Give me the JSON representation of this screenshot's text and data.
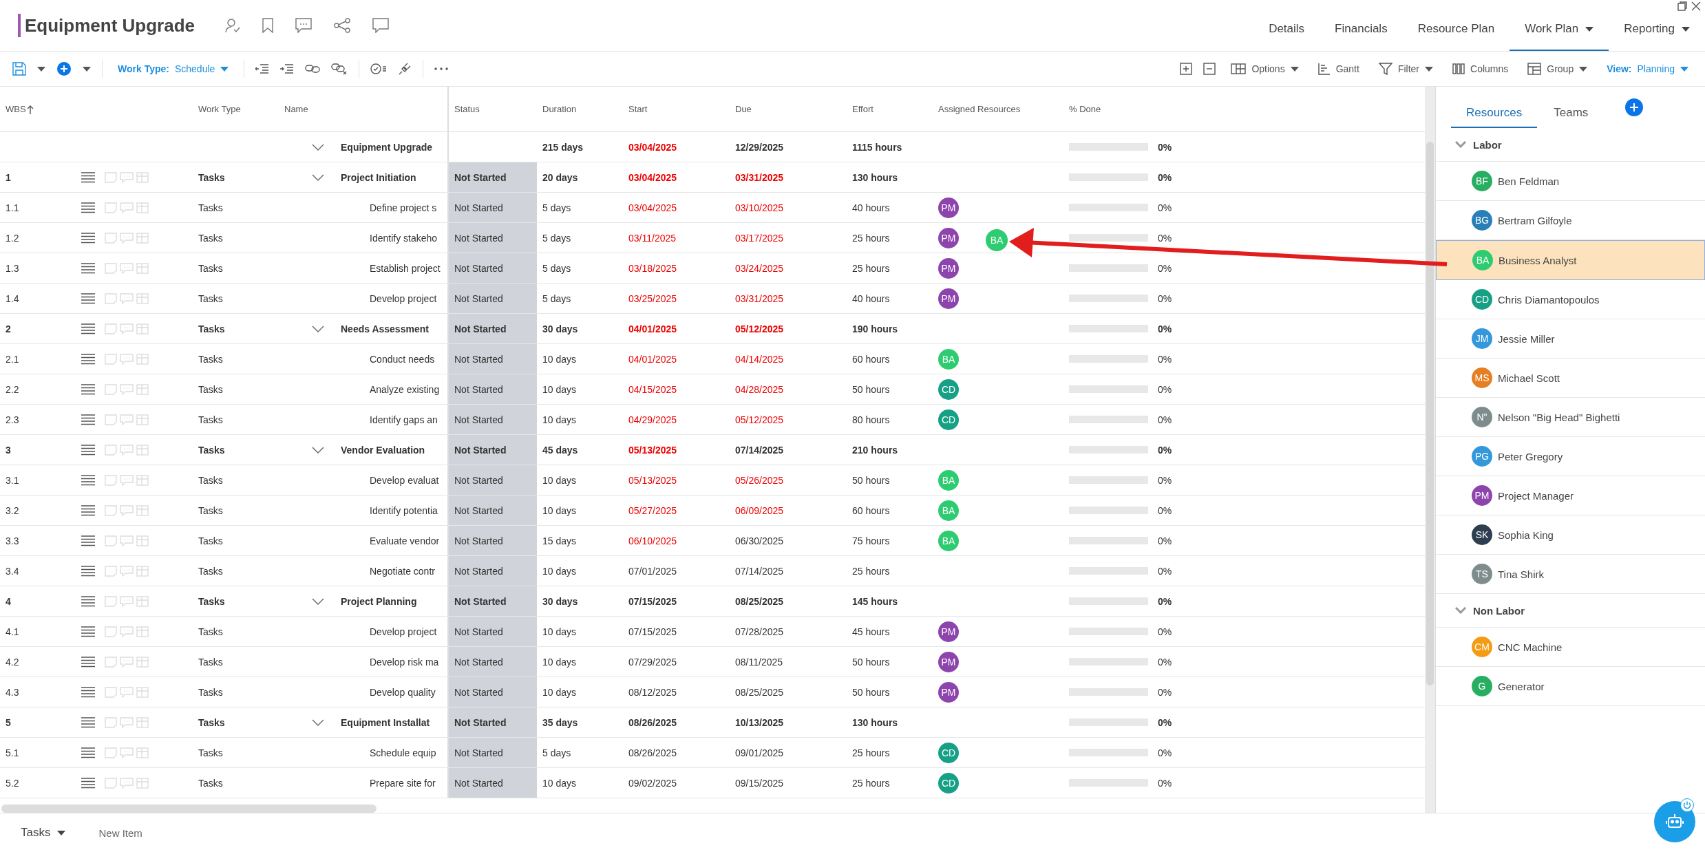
{
  "header": {
    "title": "Equipment Upgrade",
    "nav": [
      {
        "label": "Details",
        "selected": false,
        "dropdown": false
      },
      {
        "label": "Financials",
        "selected": false,
        "dropdown": false
      },
      {
        "label": "Resource Plan",
        "selected": false,
        "dropdown": false
      },
      {
        "label": "Work Plan",
        "selected": true,
        "dropdown": true
      },
      {
        "label": "Reporting",
        "selected": false,
        "dropdown": true
      }
    ]
  },
  "toolbar": {
    "work_type": {
      "label": "Work Type:",
      "value": "Schedule"
    },
    "right_buttons": [
      {
        "kind": "options",
        "label": "Options",
        "dropdown": true
      },
      {
        "kind": "gantt",
        "label": "Gantt",
        "dropdown": false
      },
      {
        "kind": "filter",
        "label": "Filter",
        "dropdown": true
      },
      {
        "kind": "columns",
        "label": "Columns",
        "dropdown": false
      },
      {
        "kind": "group",
        "label": "Group",
        "dropdown": true
      }
    ],
    "view": {
      "label": "View:",
      "value": "Planning"
    }
  },
  "table": {
    "columns": [
      "WBS",
      "Work Type",
      "Name",
      "Status",
      "Duration",
      "Start",
      "Due",
      "Effort",
      "Assigned Resources",
      "% Done"
    ],
    "rows": [
      {
        "kind": "summary",
        "wbs": "",
        "work_type": "",
        "name": "Equipment Upgrade",
        "expanded": true,
        "status": "",
        "duration": "215 days",
        "start": "03/04/2025",
        "start_late": true,
        "due": "12/29/2025",
        "due_late": false,
        "effort": "1115 hours",
        "resources": [],
        "level": 0,
        "done": "0%"
      },
      {
        "kind": "group",
        "wbs": "1",
        "work_type": "Tasks",
        "name": "Project Initiation",
        "expanded": true,
        "status": "Not Started",
        "duration": "20 days",
        "start": "03/04/2025",
        "start_late": true,
        "due": "03/31/2025",
        "due_late": true,
        "effort": "130 hours",
        "resources": [],
        "level": 0,
        "done": "0%"
      },
      {
        "kind": "task",
        "wbs": "1.1",
        "work_type": "Tasks",
        "name": "Define project s",
        "status": "Not Started",
        "duration": "5 days",
        "start": "03/04/2025",
        "start_late": true,
        "due": "03/10/2025",
        "due_late": true,
        "effort": "40 hours",
        "resources": [
          {
            "initials": "PM",
            "color": "#8e44ad"
          }
        ],
        "level": 0,
        "done": "0%"
      },
      {
        "kind": "task",
        "wbs": "1.2",
        "work_type": "Tasks",
        "name": "Identify stakeho",
        "status": "Not Started",
        "duration": "5 days",
        "start": "03/11/2025",
        "start_late": true,
        "due": "03/17/2025",
        "due_late": true,
        "effort": "25 hours",
        "resources": [
          {
            "initials": "PM",
            "color": "#8e44ad"
          }
        ],
        "level": 0,
        "done": "0%"
      },
      {
        "kind": "task",
        "wbs": "1.3",
        "work_type": "Tasks",
        "name": "Establish project",
        "status": "Not Started",
        "duration": "5 days",
        "start": "03/18/2025",
        "start_late": true,
        "due": "03/24/2025",
        "due_late": true,
        "effort": "25 hours",
        "resources": [
          {
            "initials": "PM",
            "color": "#8e44ad"
          }
        ],
        "level": 0,
        "done": "0%"
      },
      {
        "kind": "task",
        "wbs": "1.4",
        "work_type": "Tasks",
        "name": "Develop project",
        "status": "Not Started",
        "duration": "5 days",
        "start": "03/25/2025",
        "start_late": true,
        "due": "03/31/2025",
        "due_late": true,
        "effort": "40 hours",
        "resources": [
          {
            "initials": "PM",
            "color": "#8e44ad"
          }
        ],
        "level": 0,
        "done": "0%"
      },
      {
        "kind": "group",
        "wbs": "2",
        "work_type": "Tasks",
        "name": "Needs Assessment",
        "expanded": true,
        "status": "Not Started",
        "duration": "30 days",
        "start": "04/01/2025",
        "start_late": true,
        "due": "05/12/2025",
        "due_late": true,
        "effort": "190 hours",
        "resources": [],
        "level": 0,
        "done": "0%"
      },
      {
        "kind": "task",
        "wbs": "2.1",
        "work_type": "Tasks",
        "name": "Conduct needs",
        "status": "Not Started",
        "duration": "10 days",
        "start": "04/01/2025",
        "start_late": true,
        "due": "04/14/2025",
        "due_late": true,
        "effort": "60 hours",
        "resources": [
          {
            "initials": "BA",
            "color": "#2ecc71"
          }
        ],
        "level": 0,
        "done": "0%"
      },
      {
        "kind": "task",
        "wbs": "2.2",
        "work_type": "Tasks",
        "name": "Analyze existing",
        "status": "Not Started",
        "duration": "10 days",
        "start": "04/15/2025",
        "start_late": true,
        "due": "04/28/2025",
        "due_late": true,
        "effort": "50 hours",
        "resources": [
          {
            "initials": "CD",
            "color": "#16a085"
          }
        ],
        "level": 0,
        "done": "0%"
      },
      {
        "kind": "task",
        "wbs": "2.3",
        "work_type": "Tasks",
        "name": "Identify gaps an",
        "status": "Not Started",
        "duration": "10 days",
        "start": "04/29/2025",
        "start_late": true,
        "due": "05/12/2025",
        "due_late": true,
        "effort": "80 hours",
        "resources": [
          {
            "initials": "CD",
            "color": "#16a085"
          }
        ],
        "level": 0,
        "done": "0%"
      },
      {
        "kind": "group",
        "wbs": "3",
        "work_type": "Tasks",
        "name": "Vendor Evaluation",
        "expanded": true,
        "status": "Not Started",
        "duration": "45 days",
        "start": "05/13/2025",
        "start_late": true,
        "due": "07/14/2025",
        "due_late": false,
        "effort": "210 hours",
        "resources": [],
        "level": 0,
        "done": "0%"
      },
      {
        "kind": "task",
        "wbs": "3.1",
        "work_type": "Tasks",
        "name": "Develop evaluat",
        "status": "Not Started",
        "duration": "10 days",
        "start": "05/13/2025",
        "start_late": true,
        "due": "05/26/2025",
        "due_late": true,
        "effort": "50 hours",
        "resources": [
          {
            "initials": "BA",
            "color": "#2ecc71"
          }
        ],
        "level": 0,
        "done": "0%"
      },
      {
        "kind": "task",
        "wbs": "3.2",
        "work_type": "Tasks",
        "name": "Identify potentia",
        "status": "Not Started",
        "duration": "10 days",
        "start": "05/27/2025",
        "start_late": true,
        "due": "06/09/2025",
        "due_late": true,
        "effort": "60 hours",
        "resources": [
          {
            "initials": "BA",
            "color": "#2ecc71"
          }
        ],
        "level": 0,
        "done": "0%"
      },
      {
        "kind": "task",
        "wbs": "3.3",
        "work_type": "Tasks",
        "name": "Evaluate vendor",
        "status": "Not Started",
        "duration": "15 days",
        "start": "06/10/2025",
        "start_late": true,
        "due": "06/30/2025",
        "due_late": false,
        "effort": "75 hours",
        "resources": [
          {
            "initials": "BA",
            "color": "#2ecc71"
          }
        ],
        "level": 0,
        "done": "0%"
      },
      {
        "kind": "task",
        "wbs": "3.4",
        "work_type": "Tasks",
        "name": "Negotiate contr",
        "status": "Not Started",
        "duration": "10 days",
        "start": "07/01/2025",
        "start_late": false,
        "due": "07/14/2025",
        "due_late": false,
        "effort": "25 hours",
        "resources": [],
        "level": 0,
        "done": "0%"
      },
      {
        "kind": "group",
        "wbs": "4",
        "work_type": "Tasks",
        "name": "Project Planning",
        "expanded": true,
        "status": "Not Started",
        "duration": "30 days",
        "start": "07/15/2025",
        "start_late": false,
        "due": "08/25/2025",
        "due_late": false,
        "effort": "145 hours",
        "resources": [],
        "level": 0,
        "done": "0%"
      },
      {
        "kind": "task",
        "wbs": "4.1",
        "work_type": "Tasks",
        "name": "Develop project",
        "status": "Not Started",
        "duration": "10 days",
        "start": "07/15/2025",
        "start_late": false,
        "due": "07/28/2025",
        "due_late": false,
        "effort": "45 hours",
        "resources": [
          {
            "initials": "PM",
            "color": "#8e44ad"
          }
        ],
        "level": 0,
        "done": "0%"
      },
      {
        "kind": "task",
        "wbs": "4.2",
        "work_type": "Tasks",
        "name": "Develop risk ma",
        "status": "Not Started",
        "duration": "10 days",
        "start": "07/29/2025",
        "start_late": false,
        "due": "08/11/2025",
        "due_late": false,
        "effort": "50 hours",
        "resources": [
          {
            "initials": "PM",
            "color": "#8e44ad"
          }
        ],
        "level": 0,
        "done": "0%"
      },
      {
        "kind": "task",
        "wbs": "4.3",
        "work_type": "Tasks",
        "name": "Develop quality",
        "status": "Not Started",
        "duration": "10 days",
        "start": "08/12/2025",
        "start_late": false,
        "due": "08/25/2025",
        "due_late": false,
        "effort": "50 hours",
        "resources": [
          {
            "initials": "PM",
            "color": "#8e44ad"
          }
        ],
        "level": 0,
        "done": "0%"
      },
      {
        "kind": "group",
        "wbs": "5",
        "work_type": "Tasks",
        "name": "Equipment Installat",
        "expanded": true,
        "status": "Not Started",
        "duration": "35 days",
        "start": "08/26/2025",
        "start_late": false,
        "due": "10/13/2025",
        "due_late": false,
        "effort": "130 hours",
        "resources": [],
        "level": 0,
        "done": "0%"
      },
      {
        "kind": "task",
        "wbs": "5.1",
        "work_type": "Tasks",
        "name": "Schedule equip",
        "status": "Not Started",
        "duration": "5 days",
        "start": "08/26/2025",
        "start_late": false,
        "due": "09/01/2025",
        "due_late": false,
        "effort": "25 hours",
        "resources": [
          {
            "initials": "CD",
            "color": "#16a085"
          }
        ],
        "level": 0,
        "done": "0%"
      },
      {
        "kind": "task",
        "wbs": "5.2",
        "work_type": "Tasks",
        "name": "Prepare site for",
        "status": "Not Started",
        "duration": "10 days",
        "start": "09/02/2025",
        "start_late": false,
        "due": "09/15/2025",
        "due_late": false,
        "effort": "25 hours",
        "resources": [
          {
            "initials": "CD",
            "color": "#16a085"
          }
        ],
        "level": 0,
        "done": "0%"
      }
    ]
  },
  "drag_preview": {
    "initials": "BA",
    "color": "#2ecc71"
  },
  "footer": {
    "type_selector": "Tasks",
    "new_item": "New Item"
  },
  "panel": {
    "tabs": [
      {
        "label": "Resources",
        "selected": true
      },
      {
        "label": "Teams",
        "selected": false
      }
    ],
    "groups": [
      {
        "name": "Labor",
        "expanded": true,
        "items": [
          {
            "initials": "BF",
            "name": "Ben Feldman",
            "color": "#27ae60",
            "selected": false
          },
          {
            "initials": "BG",
            "name": "Bertram Gilfoyle",
            "color": "#2980b9",
            "selected": false
          },
          {
            "initials": "BA",
            "name": "Business Analyst",
            "color": "#2ecc71",
            "selected": true
          },
          {
            "initials": "CD",
            "name": "Chris Diamantopoulos",
            "color": "#16a085",
            "selected": false
          },
          {
            "initials": "JM",
            "name": "Jessie Miller",
            "color": "#3498db",
            "selected": false
          },
          {
            "initials": "MS",
            "name": "Michael Scott",
            "color": "#e67e22",
            "selected": false
          },
          {
            "initials": "N\"",
            "name": "Nelson \"Big Head\" Bighetti",
            "color": "#7f8c8d",
            "selected": false
          },
          {
            "initials": "PG",
            "name": "Peter Gregory",
            "color": "#3498db",
            "selected": false
          },
          {
            "initials": "PM",
            "name": "Project Manager",
            "color": "#8e44ad",
            "selected": false
          },
          {
            "initials": "SK",
            "name": "Sophia King",
            "color": "#2c3e50",
            "selected": false
          },
          {
            "initials": "TS",
            "name": "Tina Shirk",
            "color": "#7f8c8d",
            "selected": false
          }
        ]
      },
      {
        "name": "Non Labor",
        "expanded": true,
        "items": [
          {
            "initials": "CM",
            "name": "CNC Machine",
            "color": "#f39c12",
            "selected": false
          },
          {
            "initials": "G",
            "name": "Generator",
            "color": "#27ae60",
            "selected": false
          }
        ]
      }
    ]
  }
}
